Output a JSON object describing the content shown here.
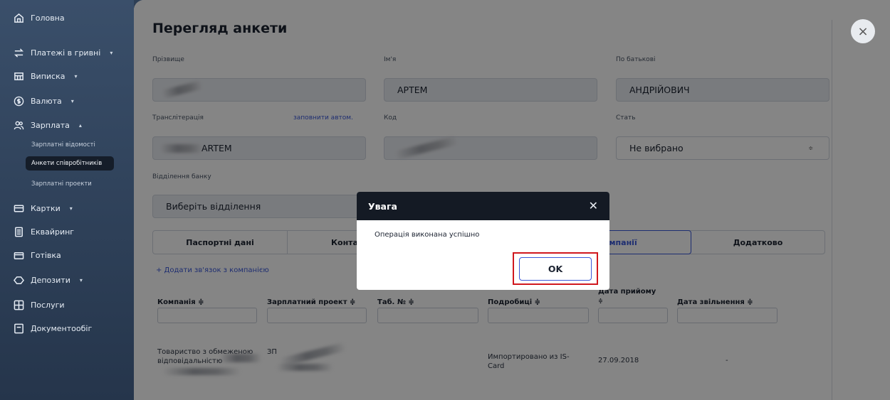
{
  "sidebar": {
    "items": [
      {
        "label": "Головна",
        "icon": "home-icon"
      },
      {
        "label": "Платежі в гривні",
        "icon": "transfer-icon",
        "caret": "▾"
      },
      {
        "label": "Виписка",
        "icon": "statement-icon",
        "caret": "▾"
      },
      {
        "label": "Валюта",
        "icon": "currency-icon",
        "caret": "▾"
      },
      {
        "label": "Зарплата",
        "icon": "people-icon",
        "caret": "▴"
      },
      {
        "label": "Картки",
        "icon": "card-icon",
        "caret": "▾"
      },
      {
        "label": "Еквайринг",
        "icon": "terminal-icon"
      },
      {
        "label": "Готівка",
        "icon": "cash-icon"
      },
      {
        "label": "Депозити",
        "icon": "deposit-icon",
        "caret": "▾"
      },
      {
        "label": "Послуги",
        "icon": "services-icon"
      },
      {
        "label": "Документообіг",
        "icon": "documents-icon"
      }
    ],
    "sub_items": [
      {
        "label": "Зарплатні відомості"
      },
      {
        "label": "Анкети співробітників",
        "active": true
      },
      {
        "label": "Зарплатні проекти"
      }
    ]
  },
  "form": {
    "title": "Перегляд анкети",
    "surname_label": "Прізвище",
    "name_label": "Ім'я",
    "name_value": "АРТЕМ",
    "patronymic_label": "По батькові",
    "patronymic_value": "АНДРІЙОВИЧ",
    "translit_label": "Транслітерація",
    "autofill_link": "заповнити автом.",
    "translit_value": "ARTEM",
    "code_label": "Код",
    "gender_label": "Стать",
    "gender_value": "Не вибрано",
    "branch_label": "Відділення банку",
    "branch_placeholder": "Виберіть відділення"
  },
  "tabs": [
    "Паспортні дані",
    "Конта",
    "омпанії",
    "Додатково"
  ],
  "add_link": "+ Додати зв'язок з компанією",
  "table": {
    "headers": [
      "Компанія ≑",
      "Зарплатний проект ≑",
      "Таб. № ≑",
      "Подробиці ≑",
      "Дата прийому",
      "≑",
      "Дата звільнення ≑"
    ],
    "row": {
      "company_line1": "Товариство з обмеженою",
      "company_line2": "відповідальністю",
      "project": "ЗП",
      "details_line1": "Импортировано из IS-",
      "details_line2": "Card",
      "hire_date": "27.09.2018",
      "dismiss_date": "-"
    }
  },
  "dialog": {
    "title": "Увага",
    "message": "Операція виконана успішно",
    "ok_label": "OK"
  },
  "colors": {
    "accent": "#3b58d8",
    "highlight": "#d0181e",
    "dialog_header": "#141a24"
  }
}
